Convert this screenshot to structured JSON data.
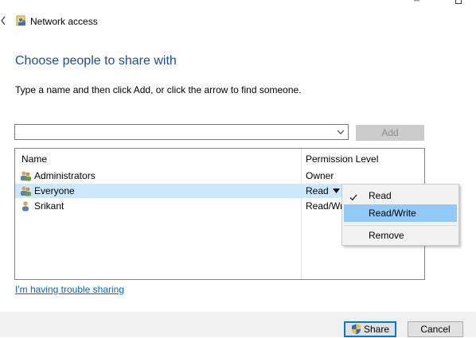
{
  "window": {
    "title": "Network access",
    "titlebar_glyph": "─"
  },
  "main": {
    "heading": "Choose people to share with",
    "instructions": "Type a name and then click Add, or click the arrow to find someone."
  },
  "name_input": {
    "value": "",
    "placeholder": ""
  },
  "add_button": "Add",
  "list": {
    "columns": {
      "name": "Name",
      "permission": "Permission Level"
    },
    "rows": [
      {
        "name": "Administrators",
        "permission": "Owner",
        "icon": "group-icon"
      },
      {
        "name": "Everyone",
        "permission": "Read",
        "icon": "group-icon",
        "selected": true
      },
      {
        "name": "Srikant",
        "permission": "Read/Wr",
        "icon": "user-icon"
      }
    ]
  },
  "permission_menu": {
    "items": [
      {
        "label": "Read",
        "checked": true
      },
      {
        "label": "Read/Write",
        "hovered": true
      },
      {
        "label": "Remove"
      }
    ]
  },
  "trouble_link": "I'm having trouble sharing",
  "buttons": {
    "share": "Share",
    "cancel": "Cancel"
  },
  "colors": {
    "heading": "#1e4d9a",
    "selection": "#cce8ff",
    "menu_hover": "#91c9f7",
    "link": "#0066cc",
    "default_button_border": "#0078d7"
  }
}
